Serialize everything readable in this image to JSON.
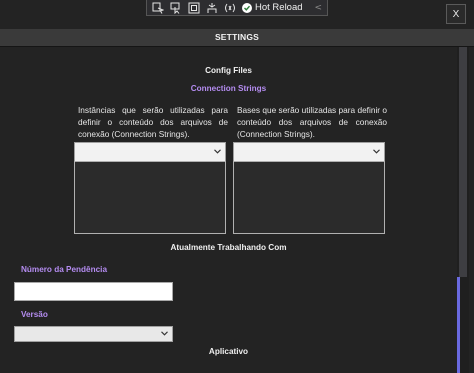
{
  "toolbar": {
    "icons": [
      "live-visual-tree-icon",
      "select-element-icon",
      "layout-adorners-icon",
      "track-focus-icon",
      "binding-failures-icon"
    ],
    "hot_reload_label": "Hot Reload",
    "collapse_glyph": "<"
  },
  "window": {
    "close_label": "X"
  },
  "header": {
    "title": "SETTINGS"
  },
  "config_files": {
    "title": "Config Files",
    "connection_strings_label": "Connection Strings",
    "instances_description": "Instâncias que serão utilizadas para definir o conteúdo dos arquivos de conexão (Connection Strings).",
    "bases_description": "Bases que serão utilizadas para definir o conteúdo dos arquivos de conexão (Connection Strings).",
    "instances_selected": "",
    "bases_selected": "",
    "instances_items": [],
    "bases_items": []
  },
  "working_on": {
    "title": "Atualmente Trabalhando Com",
    "pendencia_label": "Número da Pendência",
    "pendencia_value": "",
    "versao_label": "Versão",
    "versao_selected": ""
  },
  "aplicativo": {
    "title": "Aplicativo"
  },
  "colors": {
    "background": "#232323",
    "header_bg": "#3a3a3a",
    "accent_purple": "#b48cf0",
    "scroll_accent": "#6a6ae0"
  }
}
